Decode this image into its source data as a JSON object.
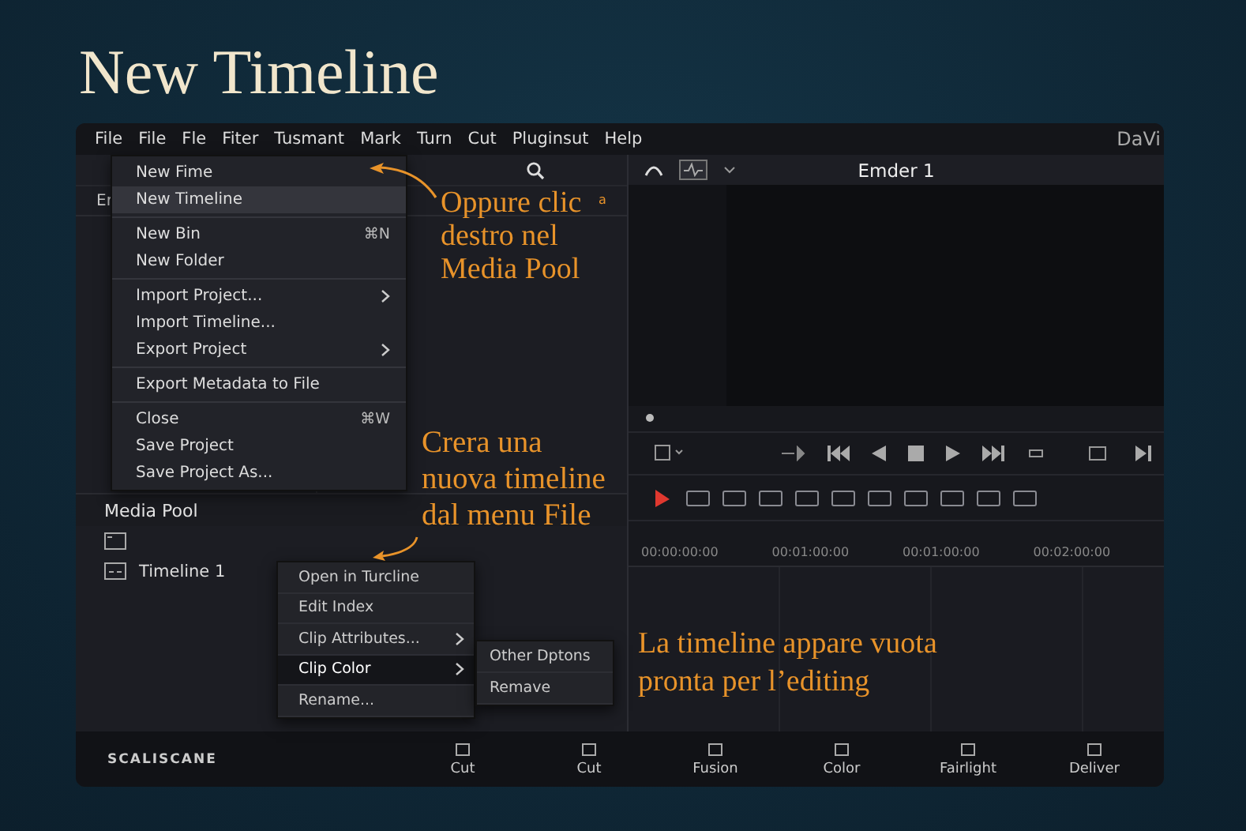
{
  "title": "New Timeline",
  "menubar": {
    "items": [
      "File",
      "File",
      "Fle",
      "Fiter",
      "Tusmant",
      "Mark",
      "Turn",
      "Cut",
      "Pluginsut",
      "Help"
    ],
    "app_name": "DaVi"
  },
  "left_panel": {
    "header_text": "Er",
    "media_pool": {
      "title": "Media Pool",
      "items": [
        {
          "kind": "folder"
        },
        {
          "kind": "timeline",
          "label": "Timeline 1"
        }
      ]
    }
  },
  "file_menu": {
    "groups": [
      [
        {
          "label": "New Fime",
          "selected": false,
          "submenu": false
        },
        {
          "label": "New Timeline",
          "selected": true,
          "submenu": false
        }
      ],
      [
        {
          "label": "New Bin",
          "shortcut": "⌘N",
          "selected": false,
          "submenu": false
        },
        {
          "label": "New Folder",
          "selected": false,
          "submenu": false
        }
      ],
      [
        {
          "label": "Import Project...",
          "selected": false,
          "submenu": true
        },
        {
          "label": "Import Timeline...",
          "selected": false,
          "submenu": false
        },
        {
          "label": "Export Project",
          "selected": false,
          "submenu": true
        }
      ],
      [
        {
          "label": "Export Metadata to File",
          "selected": false,
          "submenu": false
        }
      ],
      [
        {
          "label": "Close",
          "shortcut": "⌘W",
          "selected": false,
          "submenu": false
        },
        {
          "label": "Save Project",
          "selected": false,
          "submenu": false
        },
        {
          "label": "Save Project As...",
          "selected": false,
          "submenu": false
        }
      ]
    ]
  },
  "viewer": {
    "title": "Emder 1"
  },
  "edit_tools": [
    {
      "selected": true
    },
    {
      "selected": false
    },
    {
      "selected": false
    },
    {
      "selected": false
    },
    {
      "selected": false
    },
    {
      "selected": false
    },
    {
      "selected": false
    },
    {
      "selected": false
    },
    {
      "selected": false
    },
    {
      "selected": false
    },
    {
      "selected": false
    }
  ],
  "timeline": {
    "timecodes": [
      "00:00:00:00",
      "00:01:00:00",
      "00:01:00:00",
      "00:02:00:00"
    ]
  },
  "context_menu": {
    "items": [
      {
        "label": "Open in Turcline",
        "selected": false,
        "submenu": false
      },
      {
        "label": "Edit Index",
        "selected": false,
        "submenu": false
      },
      {
        "label": "Clip Attributes...",
        "selected": false,
        "submenu": true
      },
      {
        "label": "Clip Color",
        "selected": true,
        "submenu": true
      },
      {
        "label": "Rename...",
        "selected": false,
        "submenu": false
      }
    ]
  },
  "submenu": {
    "items": [
      "Other Dptons",
      "Remave"
    ]
  },
  "annotations": [
    {
      "text": "Oppure clic\ndestro nel\nMedia Pool",
      "mark": "a"
    },
    {
      "text": "Crera una\nnuova timeline\ndal menu File"
    },
    {
      "text": "La timeline appare vuota\npronta per l’editing"
    }
  ],
  "brand": "SCALISCANE",
  "pages": [
    "Cut",
    "Cut",
    "Fusion",
    "Color",
    "Fairlight",
    "Deliver"
  ]
}
